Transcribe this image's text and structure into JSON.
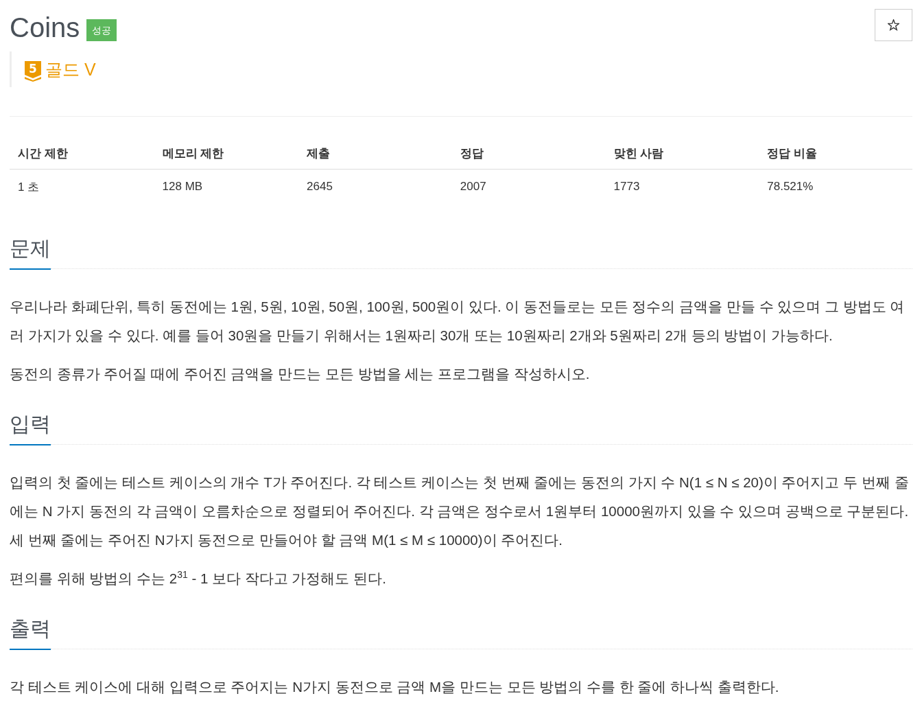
{
  "problem": {
    "title": "Coins",
    "result_badge": "성공",
    "starred": false,
    "tier": {
      "badge_number": "5",
      "name": "골드 V"
    }
  },
  "stats": {
    "columns": [
      "시간 제한",
      "메모리 제한",
      "제출",
      "정답",
      "맞힌 사람",
      "정답 비율"
    ],
    "rows": [
      [
        "1 초",
        "128 MB",
        "2645",
        "2007",
        "1773",
        "78.521%"
      ]
    ]
  },
  "sections": [
    {
      "heading": "문제",
      "paragraphs": [
        "우리나라 화폐단위, 특히 동전에는 1원, 5원, 10원, 50원, 100원, 500원이 있다. 이 동전들로는 모든 정수의 금액을 만들 수 있으며 그 방법도 여러 가지가 있을 수 있다. 예를 들어 30원을 만들기 위해서는 1원짜리 30개 또는 10원짜리 2개와 5원짜리 2개 등의 방법이 가능하다.",
        "동전의 종류가 주어질 때에 주어진 금액을 만드는 모든 방법을 세는 프로그램을 작성하시오."
      ]
    },
    {
      "heading": "입력",
      "paragraphs": [
        "입력의 첫 줄에는 테스트 케이스의 개수 T가 주어진다. 각 테스트 케이스는 첫 번째 줄에는 동전의 가지 수 N(1 ≤ N ≤ 20)이 주어지고 두 번째 줄에는 N 가지 동전의 각 금액이 오름차순으로 정렬되어 주어진다. 각 금액은 정수로서 1원부터 10000원까지 있을 수 있으며 공백으로 구분된다. 세 번째 줄에는 주어진 N가지 동전으로 만들어야 할 금액 M(1 ≤ M ≤ 10000)이 주어진다.",
        "편의를 위해 방법의 수는 2$^{31}$ - 1 보다 작다고 가정해도 된다."
      ]
    },
    {
      "heading": "출력",
      "paragraphs": [
        "각 테스트 케이스에 대해 입력으로 주어지는 N가지 동전으로 금액 M을 만드는 모든 방법의 수를 한 줄에 하나씩 출력한다."
      ]
    }
  ]
}
